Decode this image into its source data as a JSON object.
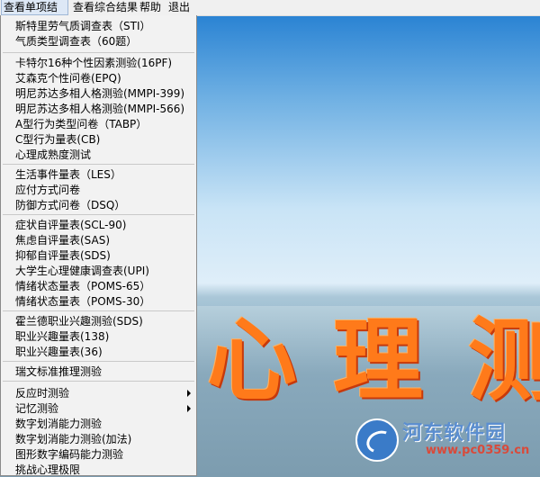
{
  "menubar": [
    "查看单项结果",
    "查看综合结果",
    "帮助",
    "退出"
  ],
  "menu": {
    "items": [
      "斯特里劳气质调查表（STI）",
      "气质类型调查表（60题）",
      "卡特尔16种个性因素测验(16PF)",
      "艾森克个性问卷(EPQ)",
      "明尼苏达多相人格测验(MMPI-399)",
      "明尼苏达多相人格测验(MMPI-566)",
      "A型行为类型问卷（TABP）",
      "C型行为量表(CB)",
      "心理成熟度测试",
      "生活事件量表（LES）",
      "应付方式问卷",
      "防御方式问卷（DSQ）",
      "症状自评量表(SCL-90)",
      "焦虑自评量表(SAS)",
      "抑郁自评量表(SDS)",
      "大学生心理健康调查表(UPI)",
      "情绪状态量表（POMS-65）",
      "情绪状态量表（POMS-30）",
      "霍兰德职业兴趣测验(SDS)",
      "职业兴趣量表(138)",
      "职业兴趣量表(36)",
      "瑞文标准推理测验",
      "反应时测验",
      "记忆测验",
      "数字划消能力测验",
      "数字划消能力测验(加法)",
      "图形数字编码能力测验",
      "挑战心理极限"
    ]
  },
  "banner": {
    "chars": [
      "心",
      "理",
      "测"
    ]
  },
  "logo": {
    "name": "河东软件园",
    "url": "www.pc0359.cn"
  }
}
